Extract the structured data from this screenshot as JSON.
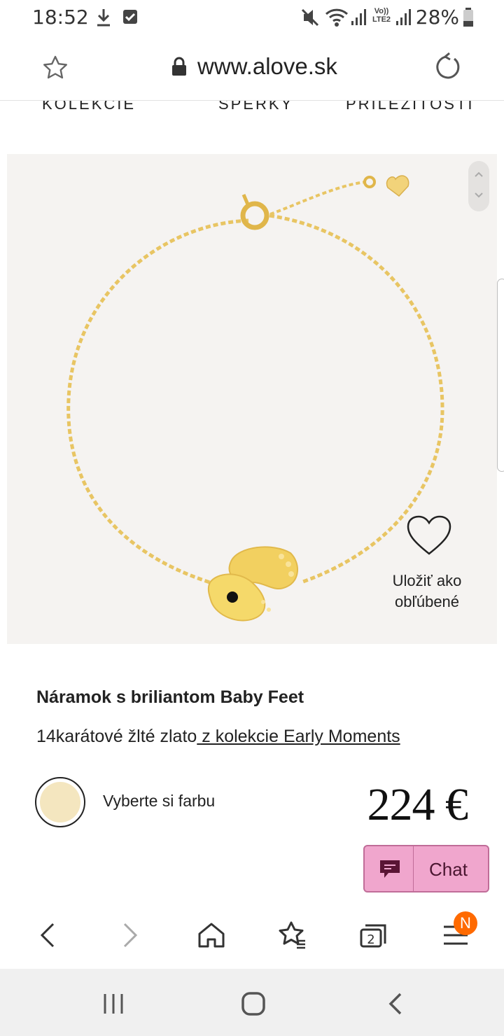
{
  "status_bar": {
    "time": "18:52",
    "battery": "28%",
    "icons": [
      "download-icon",
      "checkbox-icon",
      "mute-icon",
      "wifi-icon",
      "signal-icon",
      "volte-icon",
      "signal-icon",
      "battery-icon"
    ],
    "volte_label": "Vo)) LTE2"
  },
  "browser": {
    "url": "www.alove.sk",
    "toolbar_icons": [
      "back-icon",
      "forward-icon",
      "home-icon",
      "bookmarks-icon",
      "tabs-icon",
      "menu-icon"
    ],
    "tabs_count": "2",
    "menu_badge": "N"
  },
  "site_nav": {
    "items": [
      "KOLEKCIE",
      "ŠPERKY",
      "PRÍLEŽITOSTI"
    ]
  },
  "product": {
    "favorite_label": "Uložiť ako\nobľúbené",
    "title": "Náramok s briliantom Baby Feet",
    "material": "14karátové žlté zlato",
    "collection_link": " z kolekcie Early Moments",
    "color_label": "Vyberte si farbu",
    "price": "224 €",
    "selected_color": "#f4e6bf"
  },
  "chat": {
    "label": "Chat",
    "accent": "#f0a6cd"
  },
  "android_nav": {
    "buttons": [
      "recents-icon",
      "home-icon",
      "back-icon"
    ]
  }
}
